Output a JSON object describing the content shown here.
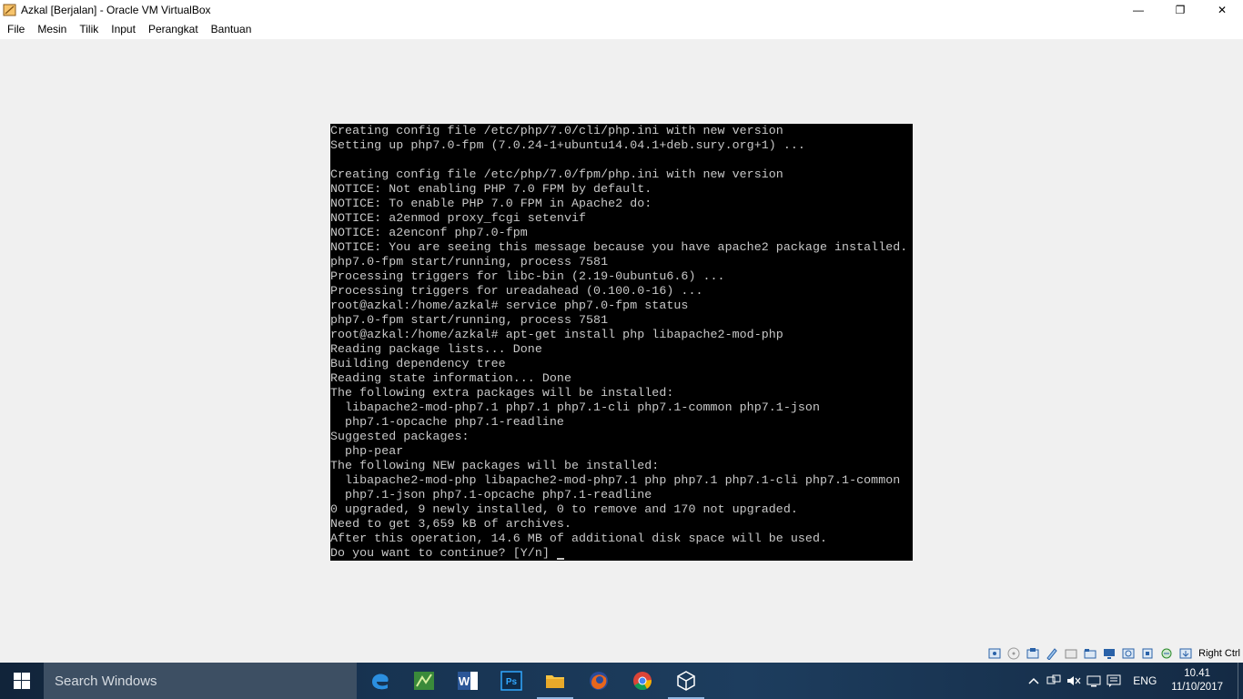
{
  "window": {
    "title": "Azkal [Berjalan] - Oracle VM VirtualBox",
    "controls": {
      "minimize": "—",
      "restore": "❐",
      "close": "✕"
    }
  },
  "menu": [
    "File",
    "Mesin",
    "Tilik",
    "Input",
    "Perangkat",
    "Bantuan"
  ],
  "console": {
    "lines": [
      "Creating config file /etc/php/7.0/cli/php.ini with new version",
      "Setting up php7.0-fpm (7.0.24-1+ubuntu14.04.1+deb.sury.org+1) ...",
      "",
      "Creating config file /etc/php/7.0/fpm/php.ini with new version",
      "NOTICE: Not enabling PHP 7.0 FPM by default.",
      "NOTICE: To enable PHP 7.0 FPM in Apache2 do:",
      "NOTICE: a2enmod proxy_fcgi setenvif",
      "NOTICE: a2enconf php7.0-fpm",
      "NOTICE: You are seeing this message because you have apache2 package installed.",
      "php7.0-fpm start/running, process 7581",
      "Processing triggers for libc-bin (2.19-0ubuntu6.6) ...",
      "Processing triggers for ureadahead (0.100.0-16) ...",
      "root@azkal:/home/azkal# service php7.0-fpm status",
      "php7.0-fpm start/running, process 7581",
      "root@azkal:/home/azkal# apt-get install php libapache2-mod-php",
      "Reading package lists... Done",
      "Building dependency tree",
      "Reading state information... Done",
      "The following extra packages will be installed:",
      "  libapache2-mod-php7.1 php7.1 php7.1-cli php7.1-common php7.1-json",
      "  php7.1-opcache php7.1-readline",
      "Suggested packages:",
      "  php-pear",
      "The following NEW packages will be installed:",
      "  libapache2-mod-php libapache2-mod-php7.1 php php7.1 php7.1-cli php7.1-common",
      "  php7.1-json php7.1-opcache php7.1-readline",
      "0 upgraded, 9 newly installed, 0 to remove and 170 not upgraded.",
      "Need to get 3,659 kB of archives.",
      "After this operation, 14.6 MB of additional disk space will be used.",
      "Do you want to continue? [Y/n] "
    ]
  },
  "statusbar": {
    "icons": [
      "hard-disk-icon",
      "optical-drive-icon",
      "audio-icon",
      "network-icon",
      "usb-icon",
      "shared-folder-icon",
      "display-icon",
      "video-capture-icon",
      "cpu-icon",
      "mouse-integration-icon",
      "keyboard-icon"
    ],
    "host_key": "Right Ctrl"
  },
  "taskbar": {
    "search_placeholder": "Search Windows",
    "apps": [
      "edge-icon",
      "spreadsheet-app-icon",
      "word-icon",
      "photoshop-icon",
      "file-explorer-icon",
      "firefox-icon",
      "chrome-icon",
      "virtualbox-icon"
    ],
    "apps_labels": {
      "word": "W",
      "photoshop": "Ps"
    },
    "lang": "ENG",
    "clock_time": "10.41",
    "clock_date": "11/10/2017"
  }
}
